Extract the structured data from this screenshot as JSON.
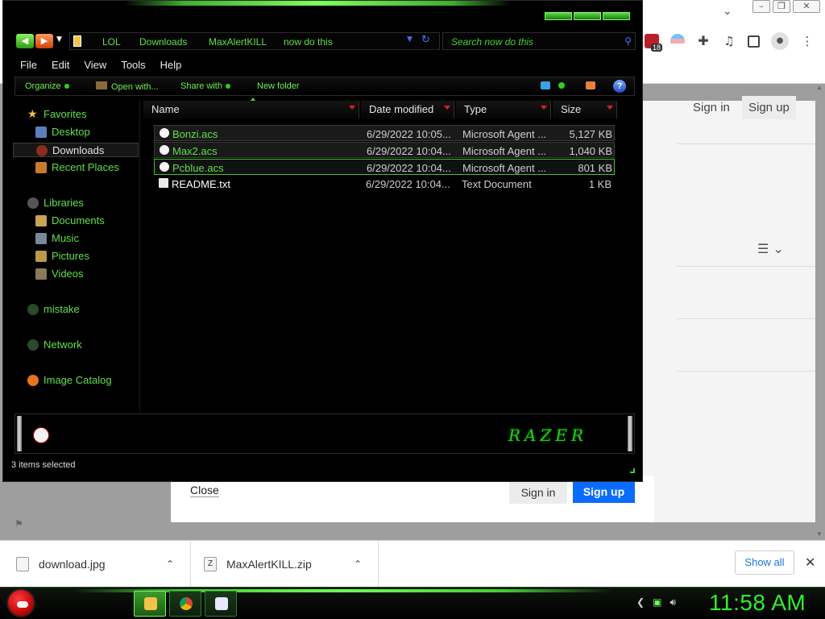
{
  "chrome": {
    "ext_badge": "18",
    "signin": "Sign in",
    "signup": "Sign up",
    "banner": {
      "close": "Close",
      "signin": "Sign in",
      "signup": "Sign up"
    }
  },
  "downloads": {
    "items": [
      {
        "name": "download.jpg"
      },
      {
        "name": "MaxAlertKILL.zip"
      }
    ],
    "show_all": "Show all"
  },
  "taskbar": {
    "clock": "11:58 AM"
  },
  "explorer": {
    "breadcrumb": [
      "LOL",
      "Downloads",
      "MaxAlertKILL",
      "now do this"
    ],
    "search_placeholder": "Search now do this",
    "menu": [
      "File",
      "Edit",
      "View",
      "Tools",
      "Help"
    ],
    "commands": {
      "organize": "Organize",
      "open_with": "Open with...",
      "share_with": "Share with",
      "new_folder": "New folder"
    },
    "nav": {
      "favorites": "Favorites",
      "desktop": "Desktop",
      "downloads": "Downloads",
      "recent": "Recent Places",
      "libraries": "Libraries",
      "documents": "Documents",
      "music": "Music",
      "pictures": "Pictures",
      "videos": "Videos",
      "mistake": "mistake",
      "network": "Network",
      "image_catalog": "Image Catalog"
    },
    "columns": {
      "name": "Name",
      "date": "Date modified",
      "type": "Type",
      "size": "Size"
    },
    "files": [
      {
        "name": "Bonzi.acs",
        "date": "6/29/2022 10:05...",
        "type": "Microsoft Agent ...",
        "size": "5,127 KB"
      },
      {
        "name": "Max2.acs",
        "date": "6/29/2022 10:04...",
        "type": "Microsoft Agent ...",
        "size": "1,040 KB"
      },
      {
        "name": "Pcblue.acs",
        "date": "6/29/2022 10:04...",
        "type": "Microsoft Agent ...",
        "size": "801 KB"
      },
      {
        "name": "README.txt",
        "date": "6/29/2022 10:04...",
        "type": "Text Document",
        "size": "1 KB"
      }
    ],
    "details_logo": "RAZER",
    "status": "3 items selected"
  }
}
